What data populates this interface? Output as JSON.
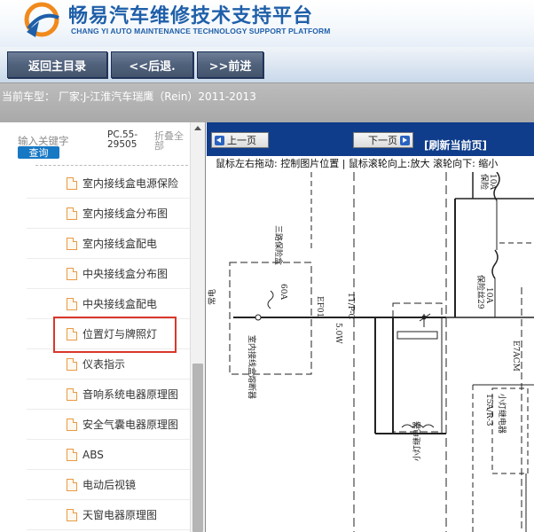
{
  "header": {
    "title": "畅易汽车维修技术支持平台",
    "subtitle": "CHANG YI AUTO MAINTENANCE TECHNOLOGY SUPPORT PLATFORM",
    "logo_icon": "changyi-logo-icon"
  },
  "toolbar": {
    "back_main": "返回主目录",
    "go_back": "<<后退.",
    "go_forward": ">>前进"
  },
  "car_info": {
    "text": "当前车型： 厂家:J-江淮汽车瑞鹰（Rein）2011-2013"
  },
  "search": {
    "placeholder": "输入关键字",
    "button": "查询",
    "pc_code": "PC.55-29505",
    "collapse_all": "折叠全部"
  },
  "tree": {
    "items": [
      {
        "label": "室内接线盒电源保险"
      },
      {
        "label": "室内接线盒分布图"
      },
      {
        "label": "室内接线盒配电"
      },
      {
        "label": "中央接线盒分布图"
      },
      {
        "label": "中央接线盒配电"
      },
      {
        "label": "位置灯与牌照灯"
      },
      {
        "label": "仪表指示"
      },
      {
        "label": "音响系统电器原理图"
      },
      {
        "label": "安全气囊电器原理图"
      },
      {
        "label": "ABS"
      },
      {
        "label": "电动后视镜"
      },
      {
        "label": "天窗电器原理图"
      }
    ],
    "selected_index": 5
  },
  "viewer": {
    "prev_page": "上一页",
    "next_page": "下一页",
    "refresh": "[刷新当前页]",
    "hint": "鼠标左右拖动: 控制图片位置 | 鼠标滚轮向上:放大  滚轮向下: 缩小"
  },
  "diagram_labels": {
    "power": "常电",
    "three_fuse": "三路保险盒",
    "box_text": "室内接线盒熔断器",
    "fuse_60a": "60A",
    "ef01": "EF01",
    "wire_5ow": "5.0W",
    "conn_c": "1T/P-C",
    "fuse29": "保险丝29",
    "fuse29_amp": "10A",
    "fuse_top": "保险",
    "fuse_top_amp": "10A",
    "relay": "小灯继电器",
    "ref_a": "15A/R-3",
    "ref_b": "小灯继电器",
    "ref_c": "E7ACM"
  },
  "colors": {
    "brand_blue": "#1f5fa9",
    "nav_blue": "#0f3d8b",
    "highlight_red": "#d9372a",
    "search_blue": "#1778c4"
  }
}
